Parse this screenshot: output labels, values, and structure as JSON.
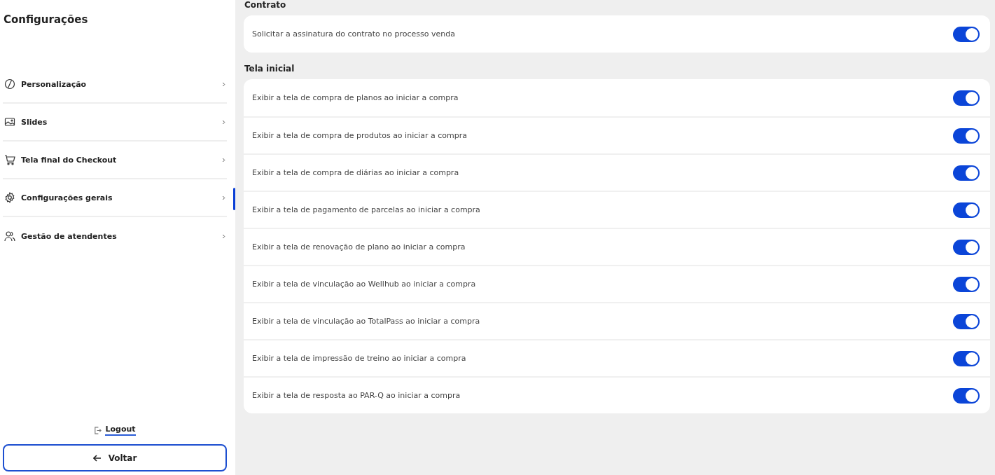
{
  "sidebar": {
    "title": "Configurações",
    "items": [
      {
        "label": "Personalização",
        "selected": false
      },
      {
        "label": "Slides",
        "selected": false
      },
      {
        "label": "Tela final do Checkout",
        "selected": false
      },
      {
        "label": "Configurações gerais",
        "selected": true
      },
      {
        "label": "Gestão de atendentes",
        "selected": false
      }
    ],
    "logout": "Logout",
    "back_button": "Voltar"
  },
  "sections": [
    {
      "title": "Contrato",
      "settings": [
        {
          "label": "Solicitar a assinatura do contrato no processo venda",
          "on": true
        }
      ]
    },
    {
      "title": "Tela inicial",
      "settings": [
        {
          "label": "Exibir a tela de compra de planos ao iniciar a compra",
          "on": true
        },
        {
          "label": "Exibir a tela de compra de produtos ao iniciar a compra",
          "on": true
        },
        {
          "label": "Exibir a tela de compra de diárias ao iniciar a compra",
          "on": true
        },
        {
          "label": "Exibir a tela de pagamento de parcelas ao iniciar a compra",
          "on": true
        },
        {
          "label": "Exibir a tela de renovação de plano ao iniciar a compra",
          "on": true
        },
        {
          "label": "Exibir a tela de vinculação ao Wellhub ao iniciar a compra",
          "on": true
        },
        {
          "label": "Exibir a tela de vinculação ao TotalPass ao iniciar a compra",
          "on": true
        },
        {
          "label": "Exibir a tela de impressão de treino ao iniciar a compra",
          "on": true
        },
        {
          "label": "Exibir a tela de resposta ao PAR-Q ao iniciar a compra",
          "on": true
        }
      ]
    }
  ]
}
